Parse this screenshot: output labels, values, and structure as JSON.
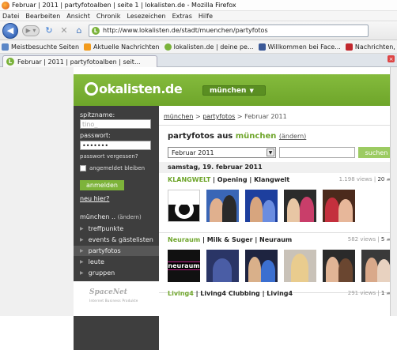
{
  "window": {
    "title": "Februar | 2011 | partyfotoalben | seite 1 | lokalisten.de - Mozilla Firefox"
  },
  "menu": [
    "Datei",
    "Bearbeiten",
    "Ansicht",
    "Chronik",
    "Lesezeichen",
    "Extras",
    "Hilfe"
  ],
  "navigation": {
    "url": "http://www.lokalisten.de/stadt/muenchen/partyfotos"
  },
  "bookmarks": [
    "Meistbesuchte Seiten",
    "Aktuelle Nachrichten",
    "lokalisten.de | deine pe...",
    "Willkommen bei Face...",
    "Nachrichten, aktuelle ..."
  ],
  "tab": {
    "title": "Februar | 2011 | partyfotoalben | seit...",
    "close": "×"
  },
  "site": {
    "logo": "okalisten.de",
    "city_button": "münchen"
  },
  "login": {
    "username_label": "spitzname:",
    "username_value": "tino_",
    "password_label": "passwort:",
    "password_value": "•••••••",
    "forgot": "passwort vergessen?",
    "remember": "angemeldet bleiben",
    "submit": "anmelden",
    "register": "neu hier?"
  },
  "sidenav": {
    "city_label": "münchen ..",
    "city_change": "(ändern)",
    "items": [
      "treffpunkte",
      "events & gästelisten",
      "partyfotos",
      "leute",
      "gruppen"
    ]
  },
  "sponsor": {
    "name": "SpaceNet",
    "tagline": "Internet Business Produkte"
  },
  "breadcrumb": {
    "city": "münchen",
    "sep1": " > ",
    "section": "partyfotos",
    "sep2": " > ",
    "current": "Februar 2011"
  },
  "heading": {
    "prefix": "partyfotos aus ",
    "city": "münchen",
    "change": "(ändern)"
  },
  "filter": {
    "month_value": "Februar 2011",
    "dropdown_arrow": "▼",
    "search_button": "suchen"
  },
  "date_header": "samstag, 19. februar 2011",
  "albums": [
    {
      "venue": "KLANGWELT",
      "rest": " | Opening | Klangwelt",
      "views": "1.198 views | ",
      "comments": "20"
    },
    {
      "venue": "Neuraum",
      "rest": " | Milk & Suger | Neuraum",
      "views": "582 views | ",
      "comments": "5"
    },
    {
      "venue": "Living4",
      "rest": " | Living4 Clubbing | Living4",
      "views": "291 views | ",
      "comments": "1"
    }
  ],
  "thumb_text": {
    "neuraum": "neuraum"
  },
  "colors": {
    "brand_green": "#6ea52a",
    "sidebar_dark": "#3e3e3e"
  }
}
